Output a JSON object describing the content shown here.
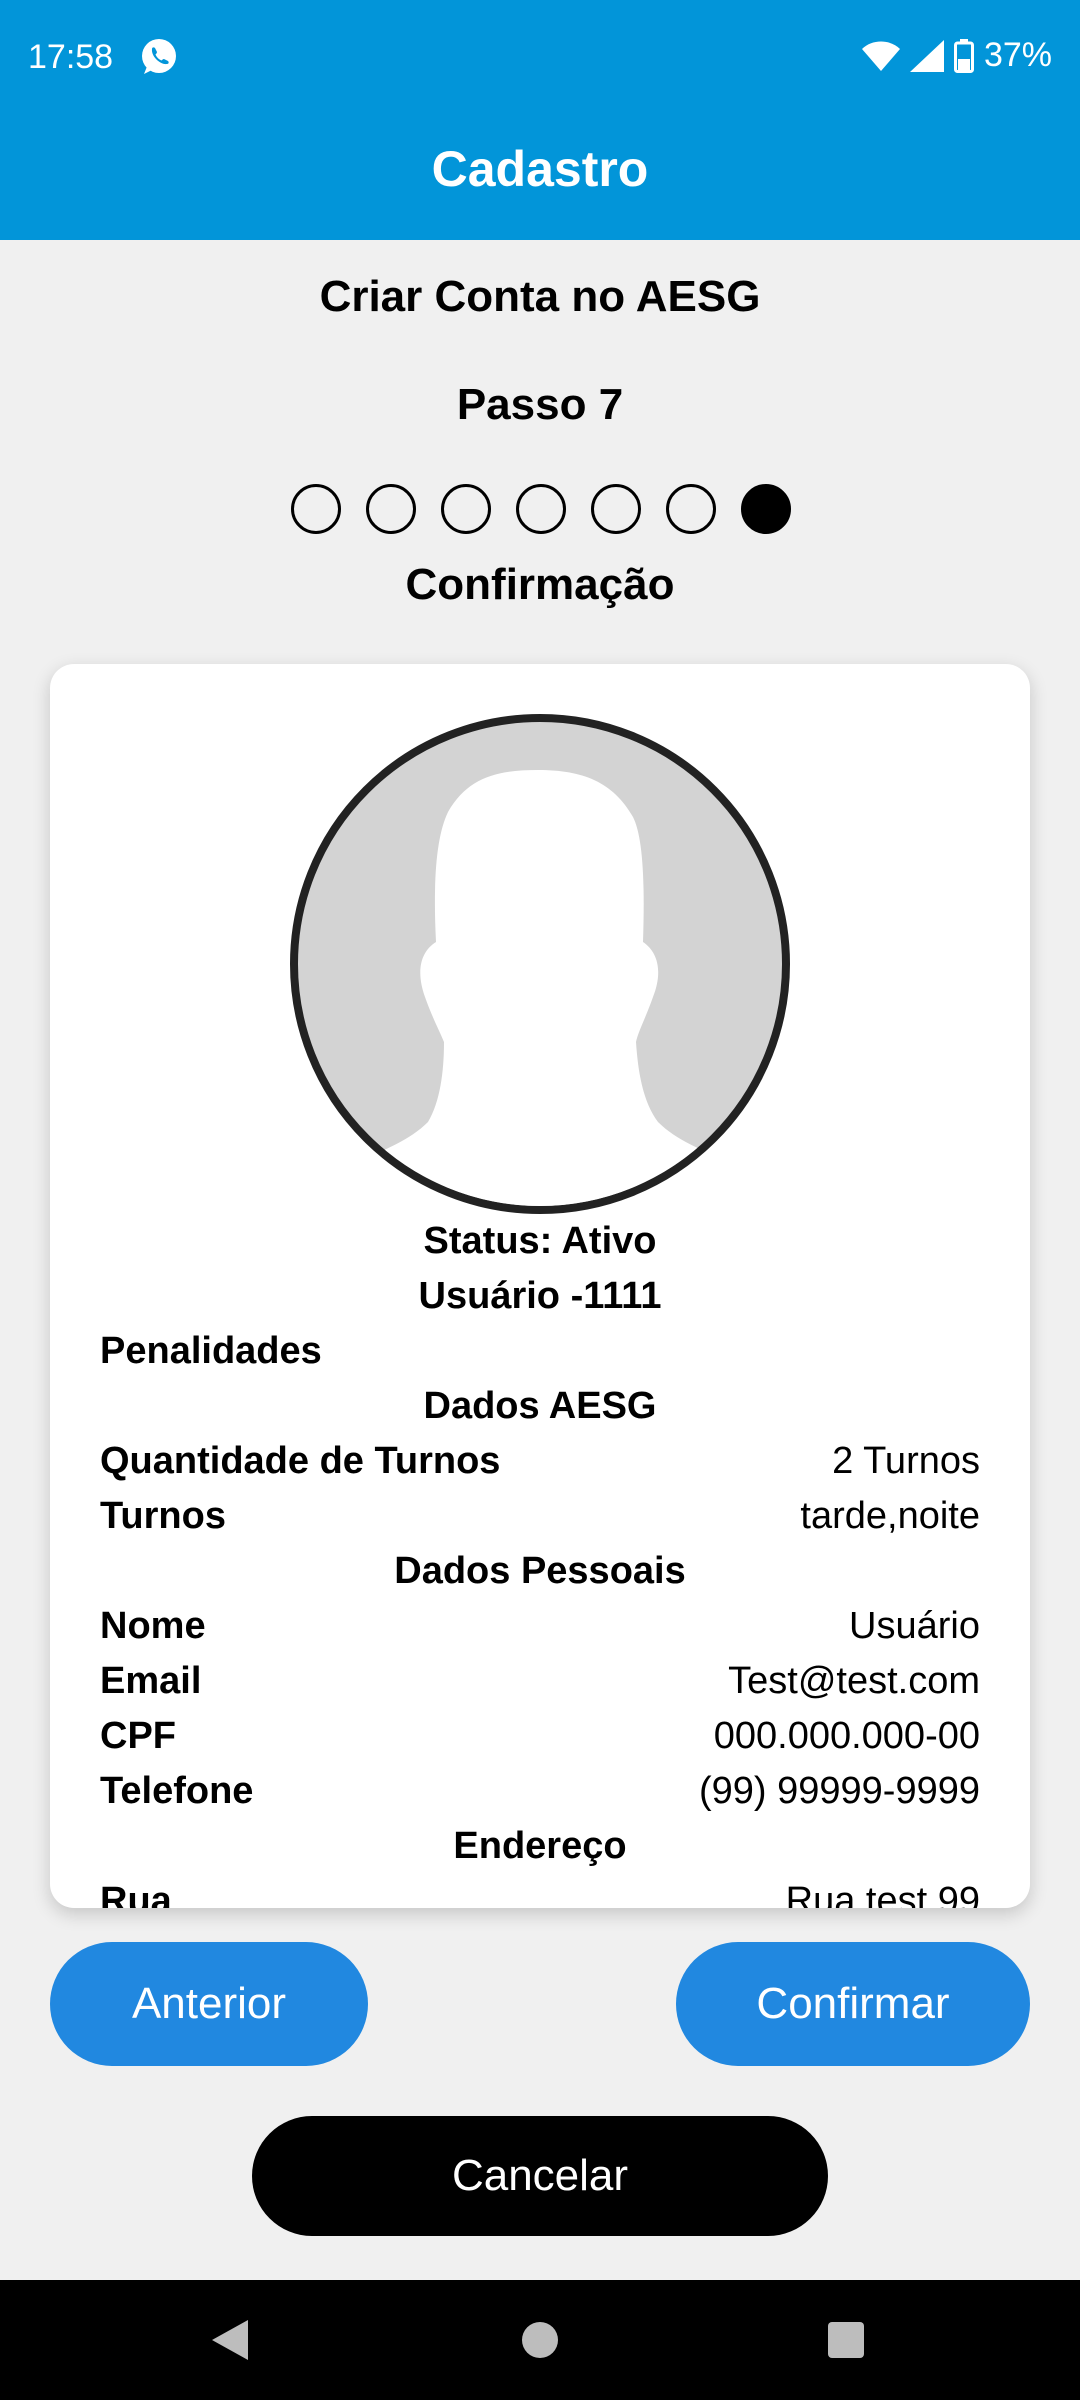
{
  "status_bar": {
    "time": "17:58",
    "app_icon": "whatsapp-icon",
    "battery": "37%"
  },
  "app_bar": {
    "title": "Cadastro"
  },
  "header": {
    "title": "Criar Conta no AESG",
    "step": "Passo 7",
    "total_steps": 7,
    "current_step": 7,
    "step_label": "Confirmação"
  },
  "profile": {
    "status": "Status: Ativo",
    "user": "Usuário -1111",
    "penalties_label": "Penalidades",
    "section_aesg": "Dados AESG",
    "shifts_qty_label": "Quantidade de Turnos",
    "shifts_qty_value": "2 Turnos",
    "shifts_label": "Turnos",
    "shifts_value": "tarde,noite",
    "section_personal": "Dados Pessoais",
    "name_label": "Nome",
    "name_value": "Usuário",
    "email_label": "Email",
    "email_value": "Test@test.com",
    "cpf_label": "CPF",
    "cpf_value": "000.000.000-00",
    "phone_label": "Telefone",
    "phone_value": "(99) 99999-9999",
    "section_address": "Endereço",
    "street_label": "Rua",
    "street_value": "Rua test 99"
  },
  "buttons": {
    "previous": "Anterior",
    "confirm": "Confirmar",
    "cancel": "Cancelar"
  },
  "colors": {
    "app_bar": "#0295d9",
    "button_primary": "#2188e0",
    "button_cancel": "#000000",
    "background": "#f0f0f0"
  }
}
